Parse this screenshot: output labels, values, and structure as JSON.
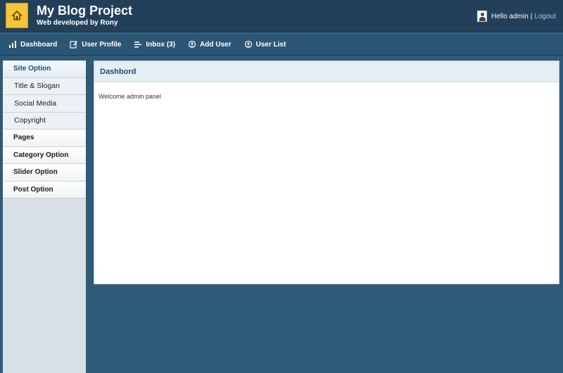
{
  "header": {
    "title": "My Blog Project",
    "subtitle": "Web developed by Rony",
    "greeting": "Hello admin",
    "separator": "|",
    "logout": "Logout"
  },
  "navbar": {
    "items": [
      {
        "label": "Dashboard",
        "icon": "bar-chart-icon"
      },
      {
        "label": "User Profile",
        "icon": "edit-icon"
      },
      {
        "label": "Inbox (3)",
        "icon": "list-icon"
      },
      {
        "label": "Add User",
        "icon": "user-icon"
      },
      {
        "label": "User List",
        "icon": "user-icon"
      }
    ]
  },
  "sidebar": {
    "items": [
      {
        "label": "Site Option"
      },
      {
        "label": "Title & Slogan"
      },
      {
        "label": "Social Media"
      },
      {
        "label": "Copyright"
      },
      {
        "label": "Pages"
      },
      {
        "label": "Category Option"
      },
      {
        "label": "Slider Option"
      },
      {
        "label": "Post Option"
      }
    ]
  },
  "panel": {
    "title": "Dashbord",
    "body": "Welcome admin panel"
  },
  "colors": {
    "background": "#2f5a78",
    "header": "#23405a",
    "logo": "#f2c53d",
    "link": "#8fd0ff",
    "panel_title": "#1d4b73"
  }
}
